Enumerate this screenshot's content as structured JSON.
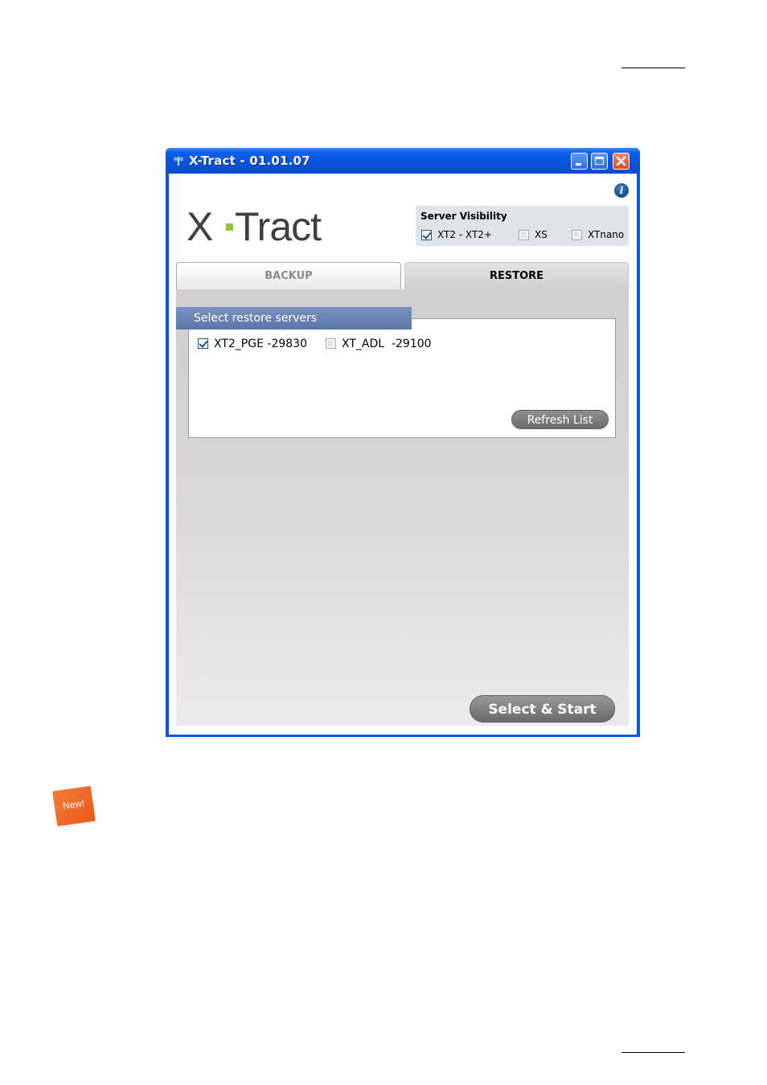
{
  "window": {
    "title": "X-Tract - 01.01.07"
  },
  "logo": {
    "text_x": "X",
    "text_tract": "Tract",
    "dot_color": "#8dc63f"
  },
  "server_visibility": {
    "title": "Server Visibility",
    "options": [
      {
        "label": "XT2 - XT2+",
        "checked": true
      },
      {
        "label": "XS",
        "checked": false
      },
      {
        "label": "XTnano",
        "checked": false
      }
    ]
  },
  "tabs": [
    {
      "label": "BACKUP",
      "active": false
    },
    {
      "label": "RESTORE",
      "active": true
    }
  ],
  "restore": {
    "section_title": "Select restore servers",
    "servers": [
      {
        "label": "XT2_PGE -29830",
        "checked": true
      },
      {
        "label": "XT_ADL  -29100",
        "checked": false
      }
    ],
    "refresh_label": "Refresh List",
    "start_label": "Select & Start"
  },
  "badge": {
    "label": "New!",
    "color": "#ef6a2a"
  },
  "icons": {
    "app": "xtract-app-icon",
    "info": "info-icon",
    "minimize": "minimize-icon",
    "maximize": "maximize-icon",
    "close": "close-icon"
  }
}
